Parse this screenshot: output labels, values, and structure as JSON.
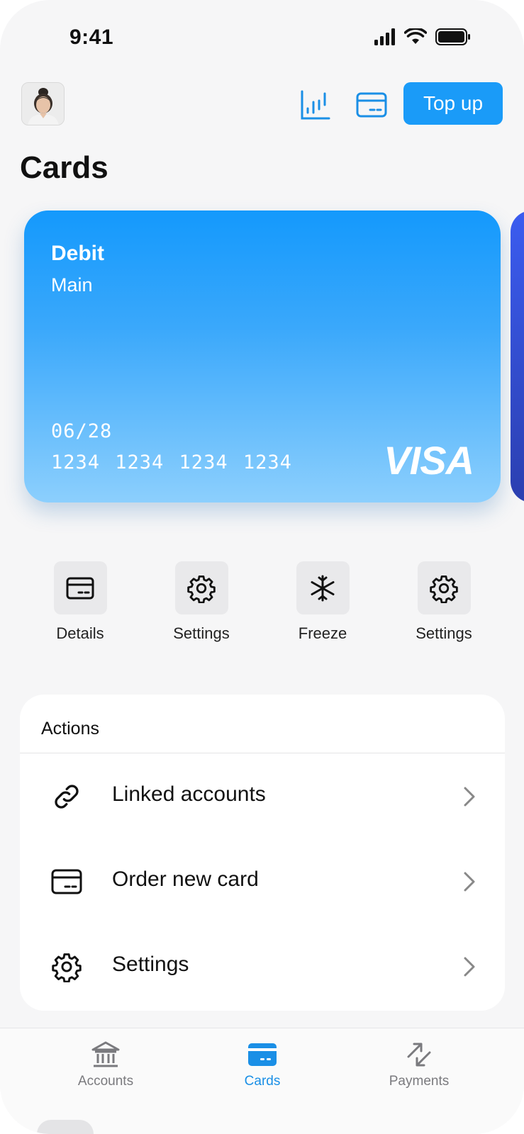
{
  "status_bar": {
    "time": "9:41"
  },
  "header": {
    "top_up_label": "Top up",
    "icons": [
      "chart-icon",
      "card-icon"
    ]
  },
  "page": {
    "title": "Cards"
  },
  "card": {
    "type": "Debit",
    "name": "Main",
    "expiry": "06/28",
    "number": "1234 1234 1234 1234",
    "brand": "VISA"
  },
  "quick_actions": [
    {
      "label": "Details",
      "icon": "card-icon"
    },
    {
      "label": "Settings",
      "icon": "gear-icon"
    },
    {
      "label": "Freeze",
      "icon": "snowflake-icon"
    },
    {
      "label": "Settings",
      "icon": "gear-icon"
    }
  ],
  "actions": {
    "title": "Actions",
    "items": [
      {
        "label": "Linked accounts",
        "icon": "link-icon"
      },
      {
        "label": "Order new card",
        "icon": "card-icon"
      },
      {
        "label": "Settings",
        "icon": "gear-icon"
      }
    ]
  },
  "bottom_nav": [
    {
      "label": "Accounts",
      "icon": "bank-icon",
      "active": false
    },
    {
      "label": "Cards",
      "icon": "card-icon",
      "active": true
    },
    {
      "label": "Payments",
      "icon": "transfer-icon",
      "active": false
    }
  ],
  "colors": {
    "accent": "#1a9bf8",
    "background": "#f6f6f7",
    "card_top": "#1499fc",
    "card_bottom": "#8ccffd",
    "nav_active": "#1a8fe6",
    "nav_inactive": "#7a7a7e"
  }
}
